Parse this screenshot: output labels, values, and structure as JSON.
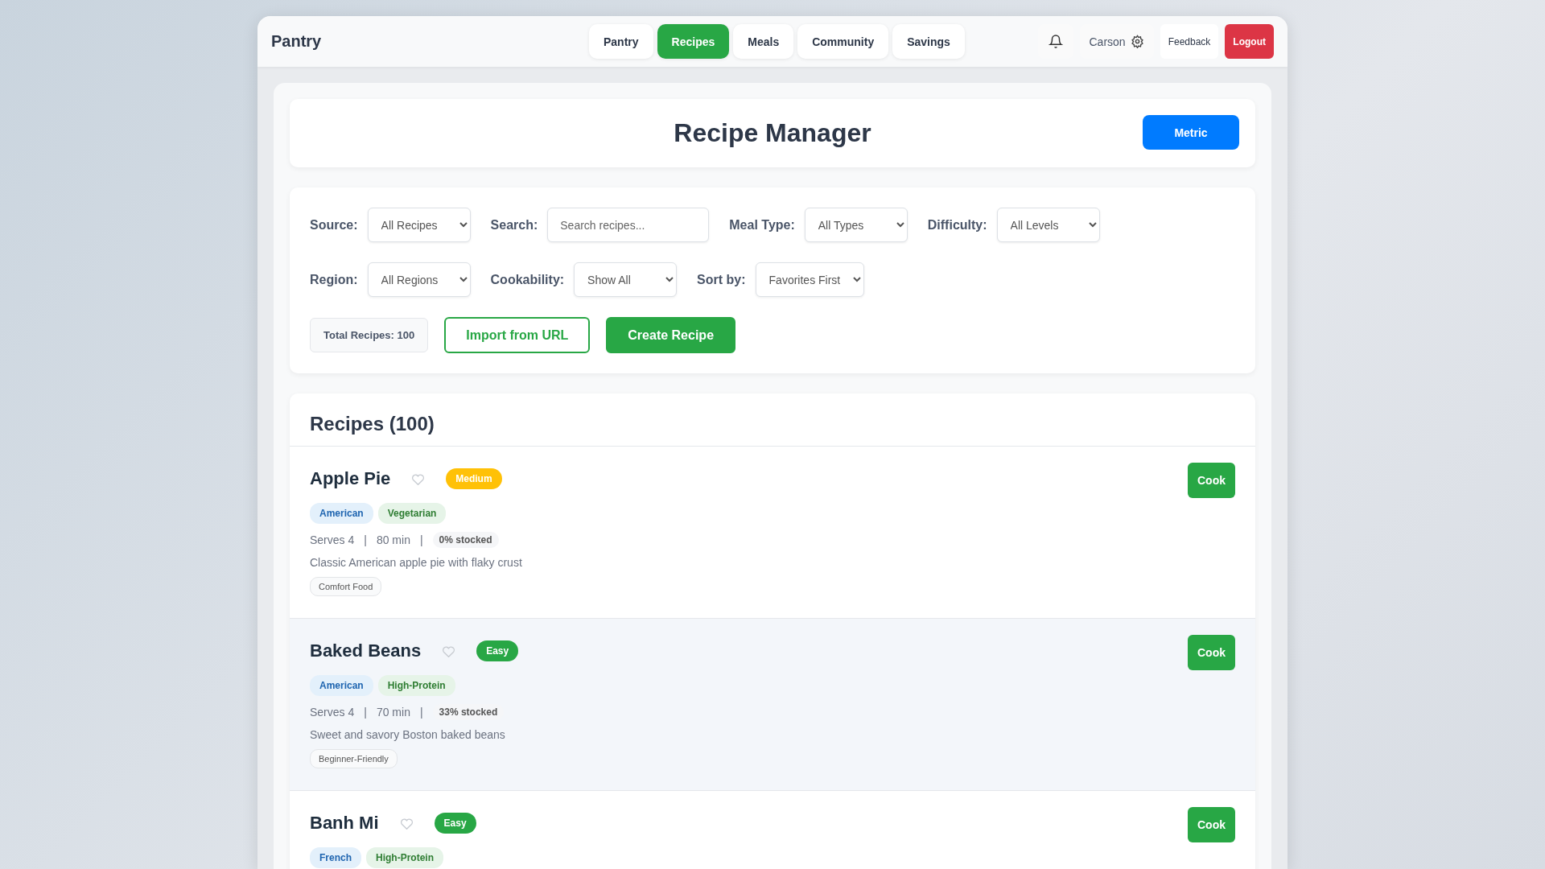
{
  "brand": "Pantry",
  "nav_tabs": [
    {
      "label": "Pantry",
      "selected": false
    },
    {
      "label": "Recipes",
      "selected": true
    },
    {
      "label": "Meals",
      "selected": false
    },
    {
      "label": "Community",
      "selected": false
    },
    {
      "label": "Savings",
      "selected": false
    }
  ],
  "user": {
    "name": "Carson"
  },
  "header_buttons": [
    {
      "label": "Feedback",
      "kind": "plain"
    },
    {
      "label": "Logout",
      "kind": "danger"
    }
  ],
  "title": "Recipe Manager",
  "unit_button": "Metric",
  "filters": [
    [
      {
        "label": "Source:",
        "kind": "select",
        "value": "All Recipes"
      },
      {
        "label": "Search:",
        "kind": "input",
        "placeholder": "Search recipes..."
      },
      {
        "label": "Meal Type:",
        "kind": "select",
        "value": "All Types"
      },
      {
        "label": "Difficulty:",
        "kind": "select",
        "value": "All Levels"
      }
    ],
    [
      {
        "label": "Region:",
        "kind": "select",
        "value": "All Regions"
      },
      {
        "label": "Cookability:",
        "kind": "select",
        "value": "Show All"
      },
      {
        "label": "Sort by:",
        "kind": "select",
        "value": "Favorites First"
      }
    ]
  ],
  "total": "Total Recipes: 100",
  "actions": [
    {
      "label": "Import from URL",
      "kind": "outline"
    },
    {
      "label": "Create Recipe",
      "kind": "solid"
    }
  ],
  "recipes_heading": "Recipes (100)",
  "recipes": [
    {
      "name": "Apple Pie",
      "favorite": false,
      "difficulty": "Medium",
      "color": "#ffc107",
      "highlighted": false,
      "tags": [
        {
          "label": "American",
          "kind": "cuisine"
        },
        {
          "label": "Vegetarian",
          "kind": "diet"
        }
      ],
      "serves": "Serves 4",
      "sep1": "|",
      "time": "80 min",
      "sep2": "|",
      "stocked": "0% stocked",
      "description": "Classic American apple pie with flaky crust",
      "labels": [
        "Comfort Food"
      ],
      "action": "Cook"
    },
    {
      "name": "Baked Beans",
      "favorite": false,
      "difficulty": "Easy",
      "color": "#28a745",
      "highlighted": true,
      "tags": [
        {
          "label": "American",
          "kind": "cuisine"
        },
        {
          "label": "High-Protein",
          "kind": "diet"
        }
      ],
      "serves": "Serves 4",
      "sep1": "|",
      "time": "70 min",
      "sep2": "|",
      "stocked": "33% stocked",
      "description": "Sweet and savory Boston baked beans",
      "labels": [
        "Beginner-Friendly"
      ],
      "action": "Cook"
    },
    {
      "name": "Banh Mi",
      "favorite": false,
      "difficulty": "Easy",
      "color": "#28a745",
      "highlighted": false,
      "tags": [
        {
          "label": "French",
          "kind": "cuisine"
        },
        {
          "label": "High-Protein",
          "kind": "diet"
        }
      ],
      "action": "Cook"
    }
  ]
}
